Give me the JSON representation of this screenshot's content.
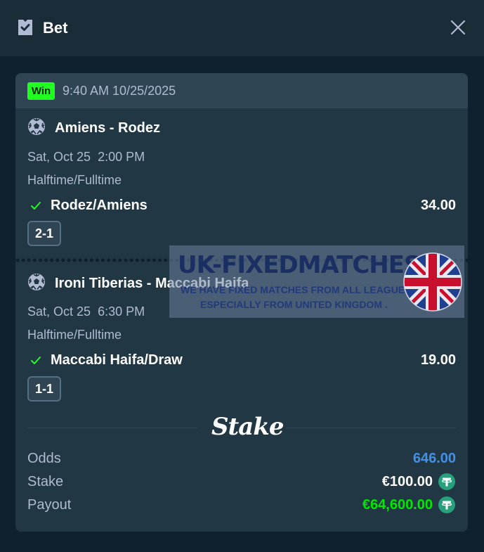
{
  "header": {
    "title": "Bet",
    "icon": "ticket-icon",
    "close_icon": "close-icon"
  },
  "bet": {
    "status": "Win",
    "placed_at": "9:40 AM 10/25/2025",
    "selections": [
      {
        "sport_icon": "soccer-ball-icon",
        "match": "Amiens - Rodez",
        "date": "Sat, Oct 25",
        "time": "2:00 PM",
        "date_time": "Sat, Oct 25  2:00 PM",
        "market": "Halftime/Fulltime",
        "pick": "Rodez/Amiens",
        "odds": "34.00",
        "result": "2-1"
      },
      {
        "sport_icon": "soccer-ball-icon",
        "match": "Ironi Tiberias - Maccabi Haifa",
        "date": "Sat, Oct 25",
        "time": "6:30 PM",
        "date_time": "Sat, Oct 25  6:30 PM",
        "market": "Halftime/Fulltime",
        "pick": "Maccabi Haifa/Draw",
        "odds": "19.00",
        "result": "1-1"
      }
    ],
    "brand": "Stake",
    "summary": {
      "odds_label": "Odds",
      "odds_value": "646.00",
      "stake_label": "Stake",
      "stake_value": "€100.00",
      "payout_label": "Payout",
      "payout_value": "€64,600.00",
      "currency_icon": "tether-icon"
    }
  },
  "watermark": {
    "title": "UK-FIXEDMATCHES",
    "line1": "WE HAVE FIXED MATCHES FROM ALL LEAGUES",
    "line2": "ESPECIALLY FROM UNITED KINGDOM .",
    "flag_icon": "uk-flag-icon"
  },
  "colors": {
    "background": "#0f212e",
    "header": "#1a2c38",
    "card": "#213743",
    "card_head": "#2f4553",
    "win_green": "#1fff20",
    "odds_blue": "#4391e7",
    "payout_green": "#00e701",
    "muted_text": "#b1bad3",
    "tether": "#26a17b"
  }
}
